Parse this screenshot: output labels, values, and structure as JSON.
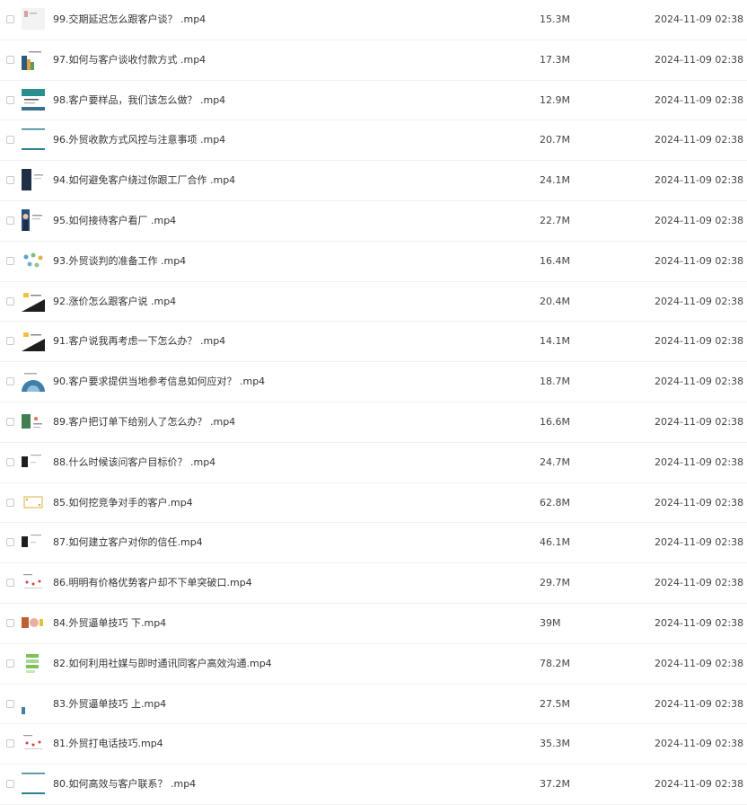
{
  "files": [
    {
      "name": "99.交期延迟怎么跟客户谈？ .mp4",
      "size": "15.3M",
      "date": "2024-11-09 02:38",
      "thumb": "slide-light"
    },
    {
      "name": "97.如何与客户谈收付款方式 .mp4",
      "size": "17.3M",
      "date": "2024-11-09 02:38",
      "thumb": "slide-colorful"
    },
    {
      "name": "98.客户要样品，我们该怎么做？ .mp4",
      "size": "12.9M",
      "date": "2024-11-09 02:38",
      "thumb": "slide-teal"
    },
    {
      "name": "96.外贸收款方式风控与注意事项 .mp4",
      "size": "20.7M",
      "date": "2024-11-09 02:38",
      "thumb": "slide-teal-line"
    },
    {
      "name": "94.如何避免客户绕过你跟工厂合作 .mp4",
      "size": "24.1M",
      "date": "2024-11-09 02:38",
      "thumb": "slide-dark-left"
    },
    {
      "name": "95.如何接待客户看厂 .mp4",
      "size": "22.7M",
      "date": "2024-11-09 02:38",
      "thumb": "slide-person"
    },
    {
      "name": "93.外贸谈判的准备工作 .mp4",
      "size": "16.4M",
      "date": "2024-11-09 02:38",
      "thumb": "slide-circles"
    },
    {
      "name": "92.涨价怎么跟客户说 .mp4",
      "size": "20.4M",
      "date": "2024-11-09 02:38",
      "thumb": "slide-yellow-dark"
    },
    {
      "name": "91.客户说我再考虑一下怎么办？ .mp4",
      "size": "14.1M",
      "date": "2024-11-09 02:38",
      "thumb": "slide-yellow-dark"
    },
    {
      "name": "90.客户要求提供当地参考信息如何应对？ .mp4",
      "size": "18.7M",
      "date": "2024-11-09 02:38",
      "thumb": "slide-blue-arc"
    },
    {
      "name": "89.客户把订单下给别人了怎么办？ .mp4",
      "size": "16.6M",
      "date": "2024-11-09 02:38",
      "thumb": "slide-green"
    },
    {
      "name": "88.什么时候该问客户目标价？ .mp4",
      "size": "24.7M",
      "date": "2024-11-09 02:38",
      "thumb": "slide-dark-block"
    },
    {
      "name": "85.如何挖竞争对手的客户.mp4",
      "size": "62.8M",
      "date": "2024-11-09 02:38",
      "thumb": "slide-yellow-box"
    },
    {
      "name": "87.如何建立客户对你的信任.mp4",
      "size": "46.1M",
      "date": "2024-11-09 02:38",
      "thumb": "slide-dark-block"
    },
    {
      "name": "86.明明有价格优势客户却不下单突破口.mp4",
      "size": "29.7M",
      "date": "2024-11-09 02:38",
      "thumb": "slide-red-dots"
    },
    {
      "name": "84.外贸逼单技巧 下.mp4",
      "size": "39M",
      "date": "2024-11-09 02:38",
      "thumb": "slide-food"
    },
    {
      "name": "82.如何利用社媒与即时通讯同客户高效沟通.mp4",
      "size": "78.2M",
      "date": "2024-11-09 02:38",
      "thumb": "slide-green-list"
    },
    {
      "name": "83.外贸逼单技巧 上.mp4",
      "size": "27.5M",
      "date": "2024-11-09 02:38",
      "thumb": "slide-blank-blue"
    },
    {
      "name": "81.外贸打电话技巧.mp4",
      "size": "35.3M",
      "date": "2024-11-09 02:38",
      "thumb": "slide-red-dots"
    },
    {
      "name": "80.如何高效与客户联系？ .mp4",
      "size": "37.2M",
      "date": "2024-11-09 02:38",
      "thumb": "slide-teal-line"
    }
  ]
}
